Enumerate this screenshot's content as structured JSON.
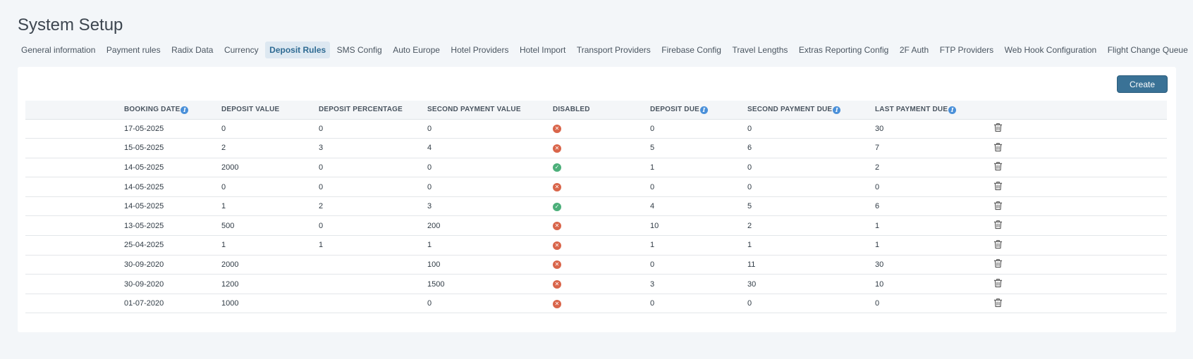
{
  "page": {
    "title": "System Setup"
  },
  "tabs": [
    {
      "label": "General information",
      "active": false
    },
    {
      "label": "Payment rules",
      "active": false
    },
    {
      "label": "Radix Data",
      "active": false
    },
    {
      "label": "Currency",
      "active": false
    },
    {
      "label": "Deposit Rules",
      "active": true
    },
    {
      "label": "SMS Config",
      "active": false
    },
    {
      "label": "Auto Europe",
      "active": false
    },
    {
      "label": "Hotel Providers",
      "active": false
    },
    {
      "label": "Hotel Import",
      "active": false
    },
    {
      "label": "Transport Providers",
      "active": false
    },
    {
      "label": "Firebase Config",
      "active": false
    },
    {
      "label": "Travel Lengths",
      "active": false
    },
    {
      "label": "Extras Reporting Config",
      "active": false
    },
    {
      "label": "2F Auth",
      "active": false
    },
    {
      "label": "FTP Providers",
      "active": false
    },
    {
      "label": "Web Hook Configuration",
      "active": false
    },
    {
      "label": "Flight Change Queue",
      "active": false
    }
  ],
  "toolbar": {
    "create_label": "Create"
  },
  "colors": {
    "accent": "#3a7296",
    "disabled_true": "#d9654a",
    "disabled_false": "#4caf7a",
    "info": "#4a90d9"
  },
  "table": {
    "headers": {
      "booking_date": "BOOKING DATE",
      "deposit_value": "DEPOSIT VALUE",
      "deposit_percentage": "DEPOSIT PERCENTAGE",
      "second_payment_value": "SECOND PAYMENT VALUE",
      "disabled": "DISABLED",
      "deposit_due": "DEPOSIT DUE",
      "second_payment_due": "SECOND PAYMENT DUE",
      "last_payment_due": "LAST PAYMENT DUE"
    },
    "rows": [
      {
        "booking_date": "17-05-2025",
        "deposit_value": "0",
        "deposit_percentage": "0",
        "second_payment_value": "0",
        "disabled": true,
        "deposit_due": "0",
        "second_payment_due": "0",
        "last_payment_due": "30"
      },
      {
        "booking_date": "15-05-2025",
        "deposit_value": "2",
        "deposit_percentage": "3",
        "second_payment_value": "4",
        "disabled": true,
        "deposit_due": "5",
        "second_payment_due": "6",
        "last_payment_due": "7"
      },
      {
        "booking_date": "14-05-2025",
        "deposit_value": "2000",
        "deposit_percentage": "0",
        "second_payment_value": "0",
        "disabled": false,
        "deposit_due": "1",
        "second_payment_due": "0",
        "last_payment_due": "2"
      },
      {
        "booking_date": "14-05-2025",
        "deposit_value": "0",
        "deposit_percentage": "0",
        "second_payment_value": "0",
        "disabled": true,
        "deposit_due": "0",
        "second_payment_due": "0",
        "last_payment_due": "0"
      },
      {
        "booking_date": "14-05-2025",
        "deposit_value": "1",
        "deposit_percentage": "2",
        "second_payment_value": "3",
        "disabled": false,
        "deposit_due": "4",
        "second_payment_due": "5",
        "last_payment_due": "6"
      },
      {
        "booking_date": "13-05-2025",
        "deposit_value": "500",
        "deposit_percentage": "0",
        "second_payment_value": "200",
        "disabled": true,
        "deposit_due": "10",
        "second_payment_due": "2",
        "last_payment_due": "1"
      },
      {
        "booking_date": "25-04-2025",
        "deposit_value": "1",
        "deposit_percentage": "1",
        "second_payment_value": "1",
        "disabled": true,
        "deposit_due": "1",
        "second_payment_due": "1",
        "last_payment_due": "1"
      },
      {
        "booking_date": "30-09-2020",
        "deposit_value": "2000",
        "deposit_percentage": "",
        "second_payment_value": "100",
        "disabled": true,
        "deposit_due": "0",
        "second_payment_due": "11",
        "last_payment_due": "30"
      },
      {
        "booking_date": "30-09-2020",
        "deposit_value": "1200",
        "deposit_percentage": "",
        "second_payment_value": "1500",
        "disabled": true,
        "deposit_due": "3",
        "second_payment_due": "30",
        "last_payment_due": "10"
      },
      {
        "booking_date": "01-07-2020",
        "deposit_value": "1000",
        "deposit_percentage": "",
        "second_payment_value": "0",
        "disabled": true,
        "deposit_due": "0",
        "second_payment_due": "0",
        "last_payment_due": "0"
      }
    ]
  }
}
